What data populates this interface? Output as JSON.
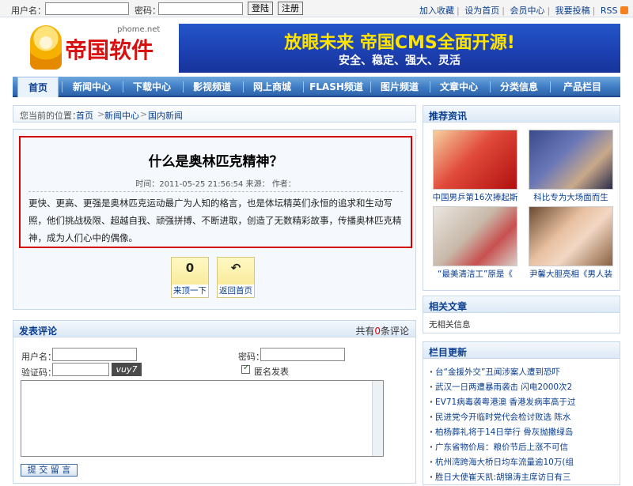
{
  "topbar": {
    "username_label": "用户名：",
    "password_label": "密码：",
    "login_button": "登陆",
    "register_button": "注册",
    "links": [
      "加入收藏",
      "设为首页",
      "会员中心",
      "我要投稿",
      "RSS"
    ]
  },
  "logo": {
    "url_text": "phome.net",
    "name": "帝国软件"
  },
  "banner": {
    "line1": "放眼未来 帝国CMS全面开源!",
    "line2": "安全、稳定、强大、灵活"
  },
  "nav": [
    "首页",
    "新闻中心",
    "下载中心",
    "影视频道",
    "网上商城",
    "FLASH频道",
    "图片频道",
    "文章中心",
    "分类信息",
    "产品栏目"
  ],
  "breadcrumb": {
    "prefix": "您当前的位置：",
    "items": [
      "首页",
      "新闻中心",
      "国内新闻"
    ],
    "sep": ">"
  },
  "article": {
    "title": "什么是奥林匹克精神？",
    "meta": "时间：2011-05-25 21:56:54  来源：  作者：",
    "body": "更快、更高、更强是奥林匹克运动最广为人知的格言，也是体坛精英们永恒的追求和生动写照，他们挑战极限、超越自我、顽强拼搏、不断进取，创造了无数精彩故事，传播奥林匹克精神，成为人们心中的偶像。"
  },
  "actions": {
    "digg": {
      "count": "0",
      "label": "来顶一下"
    },
    "home": {
      "icon": "↶",
      "label": "返回首页"
    }
  },
  "comment": {
    "title": "发表评论",
    "count_prefix": "共有",
    "count": "0",
    "count_suffix": "条评论",
    "username_label": "用户名：",
    "password_label": "密码：",
    "captcha_label": "验证码：",
    "captcha_text": "vuy7",
    "anonymous_label": "匿名发表",
    "submit_label": "提 交 留 言"
  },
  "recommend": {
    "title": "推荐资讯",
    "items": [
      "中国男乒第16次捧起斯",
      "科比专为大场面而生",
      "“最美清洁工”原是《",
      "尹馨大胆亮相《男人装"
    ]
  },
  "related": {
    "title": "相关文章",
    "empty": "无相关信息"
  },
  "updates": {
    "title": "栏目更新",
    "items": [
      "台“金援外交”丑闻涉案人遭到恐吓",
      "武汉一日两遭暴雨袭击 闪电2000次2",
      "EV71病毒袭粤港澳 香港发病率高于过",
      "民进党今开临时党代会检讨败选 陈水",
      "柏杨葬礼将于14日举行 骨灰抛撒绿岛",
      "广东省物价局：粮价节后上涨不可信",
      "杭州湾跨海大桥日均车流量逾10万(组",
      "胜日大使崔天凯:胡锦涛主席访日有三"
    ]
  },
  "colors": {
    "accent": "#0b3e8f",
    "highlight_border": "#d60000",
    "nav_bg": "#3f7cc4"
  }
}
